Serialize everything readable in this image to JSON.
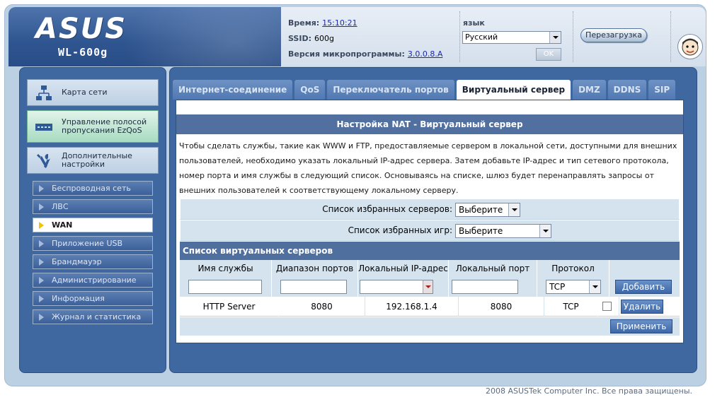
{
  "header": {
    "brand": "ASUS",
    "model": "WL-600g",
    "time_label": "Время:",
    "time_value": "15:10:21",
    "ssid_label": "SSID:",
    "ssid_value": "600g",
    "firmware_label": "Версия микропрограммы:",
    "firmware_value": "3.0.0.8.A",
    "language_label": "язык",
    "language_value": "Русский",
    "ok_label": "OK",
    "reboot_label": "Перезагрузка"
  },
  "sidebar": {
    "main_items": [
      {
        "label": "Карта сети",
        "icon": "network-map-icon"
      },
      {
        "label": "Управление полосой пропускания EzQoS",
        "icon": "ezqos-icon"
      },
      {
        "label": "Дополнительные настройки",
        "icon": "tools-icon"
      }
    ],
    "sub_items": [
      {
        "label": "Беспроводная сеть"
      },
      {
        "label": "ЛВС"
      },
      {
        "label": "WAN"
      },
      {
        "label": "Приложение USB"
      },
      {
        "label": "Брандмауэр"
      },
      {
        "label": "Администрирование"
      },
      {
        "label": "Информация"
      },
      {
        "label": "Журнал и статистика"
      }
    ]
  },
  "tabs": [
    {
      "label": "Интернет-соединение"
    },
    {
      "label": "QoS"
    },
    {
      "label": "Переключатель портов"
    },
    {
      "label": "Виртуальный сервер"
    },
    {
      "label": "DMZ"
    },
    {
      "label": "DDNS"
    },
    {
      "label": "SIP"
    }
  ],
  "content": {
    "title": "Настройка NAT - Виртуальный сервер",
    "description": "Чтобы сделать службы, такие как WWW и FTP, предоставляемые сервером в локальной сети, доступными для внешних пользователей, необходимо указать локальный IP-адрес сервера. Затем добавьте IP-адрес и тип сетевого протокола, номер порта и имя службы в следующий список. Основываясь на списке, шлюз будет перенаправлять запросы от внешних пользователей к соответствующему локальному серверу.",
    "fav_servers_label": "Список избранных серверов:",
    "fav_servers_value": "Выберите",
    "fav_games_label": "Список избранных игр:",
    "fav_games_value": "Выберите",
    "vs_list_title": "Список виртуальных серверов",
    "columns": [
      "Имя службы",
      "Диапазон портов",
      "Локальный IP-адрес",
      "Локальный порт",
      "Протокол"
    ],
    "new_protocol": "TCP",
    "add_label": "Добавить",
    "rows": [
      {
        "service": "HTTP Server",
        "port_range": "8080",
        "local_ip": "192.168.1.4",
        "local_port": "8080",
        "protocol": "TCP"
      }
    ],
    "delete_label": "Удалить",
    "apply_label": "Применить"
  },
  "footer": {
    "copyright": "2008 ASUSTek Computer Inc. Все права защищены."
  }
}
